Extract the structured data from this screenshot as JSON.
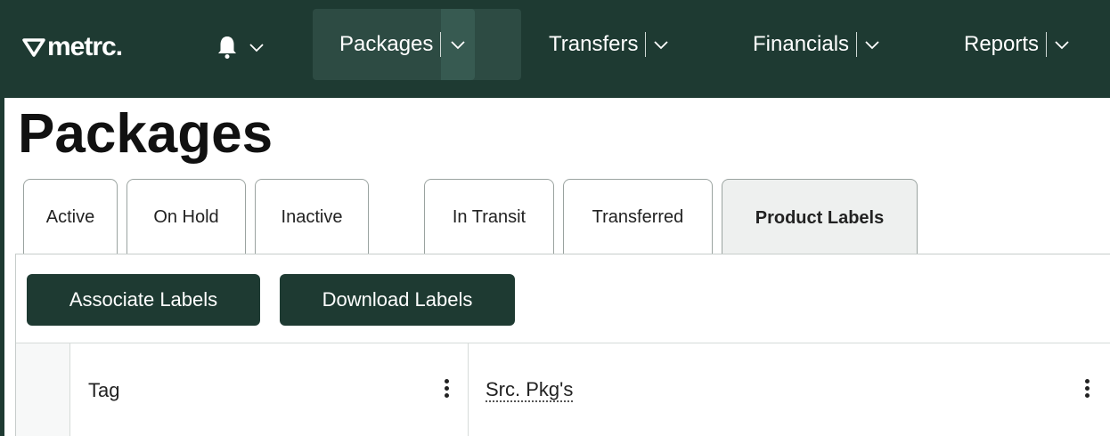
{
  "app": {
    "logo_text": "metrc.",
    "colors": {
      "nav_bg": "#1e3a32",
      "button_bg": "#1e3a32",
      "tab_selected_bg": "#eef0ef"
    }
  },
  "nav": {
    "bell_icon": "bell-icon",
    "items": [
      {
        "label": "Packages",
        "active": true
      },
      {
        "label": "Transfers",
        "active": false
      },
      {
        "label": "Financials",
        "active": false
      },
      {
        "label": "Reports",
        "active": false
      }
    ]
  },
  "page": {
    "title": "Packages"
  },
  "tabs": [
    {
      "label": "Active",
      "selected": false
    },
    {
      "label": "On Hold",
      "selected": false
    },
    {
      "label": "Inactive",
      "selected": false
    },
    {
      "label": "In Transit",
      "selected": false
    },
    {
      "label": "Transferred",
      "selected": false
    },
    {
      "label": "Product Labels",
      "selected": true
    }
  ],
  "toolbar": {
    "associate_label": "Associate Labels",
    "download_label": "Download Labels"
  },
  "grid": {
    "columns": [
      {
        "label": "Tag"
      },
      {
        "label": "Src. Pkg's"
      }
    ]
  }
}
